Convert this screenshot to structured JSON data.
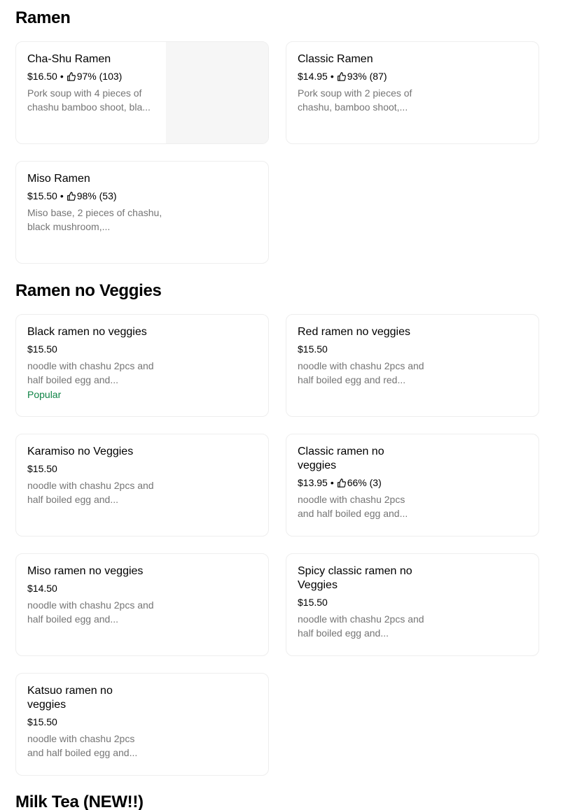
{
  "sections": {
    "ramen": {
      "title": "Ramen",
      "items": [
        {
          "name": "Cha-Shu Ramen",
          "price": "$16.50",
          "rating": "97% (103)",
          "description": "Pork soup with 4 pieces of chashu bamboo shoot, bla..."
        },
        {
          "name": "Classic Ramen",
          "price": "$14.95",
          "rating": "93% (87)",
          "description": "Pork soup with 2 pieces of chashu, bamboo shoot,..."
        },
        {
          "name": "Miso Ramen",
          "price": "$15.50",
          "rating": "98% (53)",
          "description": "Miso base, 2 pieces of chashu, black mushroom,..."
        }
      ]
    },
    "ramen_no_veggies": {
      "title": "Ramen no Veggies",
      "items": [
        {
          "name": "Black ramen no veggies",
          "price": "$15.50",
          "description": "noodle with chashu 2pcs and half boiled egg and...",
          "badge": "Popular"
        },
        {
          "name": "Red ramen no veggies",
          "price": "$15.50",
          "description": "noodle with chashu 2pcs and half boiled egg and red..."
        },
        {
          "name": "Karamiso no Veggies",
          "price": "$15.50",
          "description": "noodle with chashu 2pcs and half boiled egg and..."
        },
        {
          "name": "Classic ramen no veggies",
          "price": "$13.95",
          "rating": "66% (3)",
          "description": "noodle with chashu 2pcs and half boiled egg and..."
        },
        {
          "name": "Miso ramen no veggies",
          "price": "$14.50",
          "description": "noodle with chashu 2pcs and half boiled egg and..."
        },
        {
          "name": "Spicy classic ramen no Veggies",
          "price": "$15.50",
          "description": "noodle with chashu 2pcs and half boiled egg and..."
        },
        {
          "name": "Katsuo ramen no veggies",
          "price": "$15.50",
          "description": "noodle with chashu 2pcs and half boiled egg and..."
        }
      ]
    },
    "milk_tea": {
      "title": "Milk Tea (NEW!!)"
    }
  },
  "separator": "•",
  "icons": {
    "rating": "thumbs-up-icon"
  },
  "colors": {
    "popular": "#0e8345",
    "description": "#757575",
    "border": "#eeeeee"
  }
}
